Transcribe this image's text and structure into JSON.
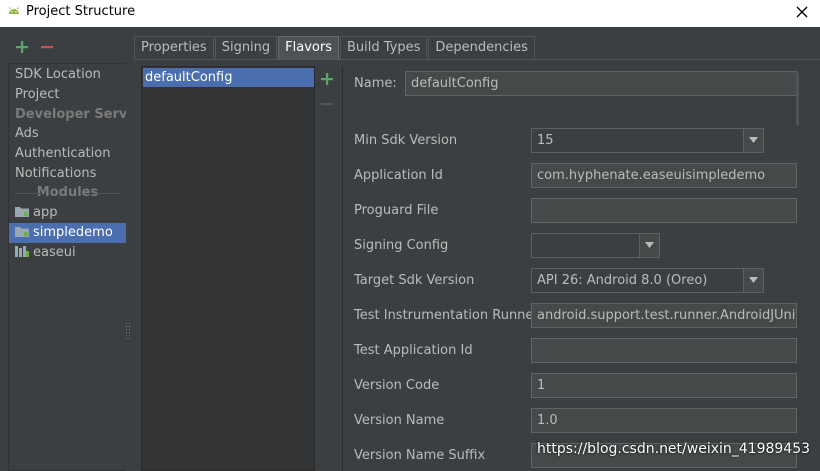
{
  "window": {
    "title": "Project Structure",
    "icon": "android-icon",
    "close_icon": "close-icon"
  },
  "toolbar": {
    "add_icon": "plus-icon",
    "remove_icon": "minus-icon"
  },
  "sidebar": {
    "items": [
      {
        "label": "SDK Location"
      },
      {
        "label": "Project"
      },
      {
        "label": "Developer Servi..."
      },
      {
        "label": "Ads"
      },
      {
        "label": "Authentication"
      },
      {
        "label": "Notifications"
      },
      {
        "label": "Modules"
      },
      {
        "label": "app"
      },
      {
        "label": "simpledemo"
      },
      {
        "label": "easeui"
      }
    ]
  },
  "tabs": [
    {
      "label": "Properties"
    },
    {
      "label": "Signing"
    },
    {
      "label": "Flavors"
    },
    {
      "label": "Build Types"
    },
    {
      "label": "Dependencies"
    }
  ],
  "flavors": {
    "items": [
      "defaultConfig"
    ]
  },
  "form": {
    "name_label": "Name:",
    "name_value": "defaultConfig",
    "fields": [
      {
        "label": "Min Sdk Version",
        "value": "15"
      },
      {
        "label": "Application Id",
        "value": "com.hyphenate.easeuisimpledemo"
      },
      {
        "label": "Proguard File",
        "value": ""
      },
      {
        "label": "Signing Config",
        "value": ""
      },
      {
        "label": "Target Sdk Version",
        "value": "API 26: Android 8.0 (Oreo)"
      },
      {
        "label": "Test Instrumentation Runner",
        "value": "android.support.test.runner.AndroidJUnitRunner"
      },
      {
        "label": "Test Application Id",
        "value": ""
      },
      {
        "label": "Version Code",
        "value": "1"
      },
      {
        "label": "Version Name",
        "value": "1.0"
      },
      {
        "label": "Version Name Suffix",
        "value": ""
      }
    ]
  },
  "watermark": "https://blog.csdn.net/weixin_41989453",
  "colors": {
    "background": "#3c3f41",
    "selection": "#4b6eaf",
    "add_green": "#59a869",
    "remove_red": "#c75450"
  }
}
